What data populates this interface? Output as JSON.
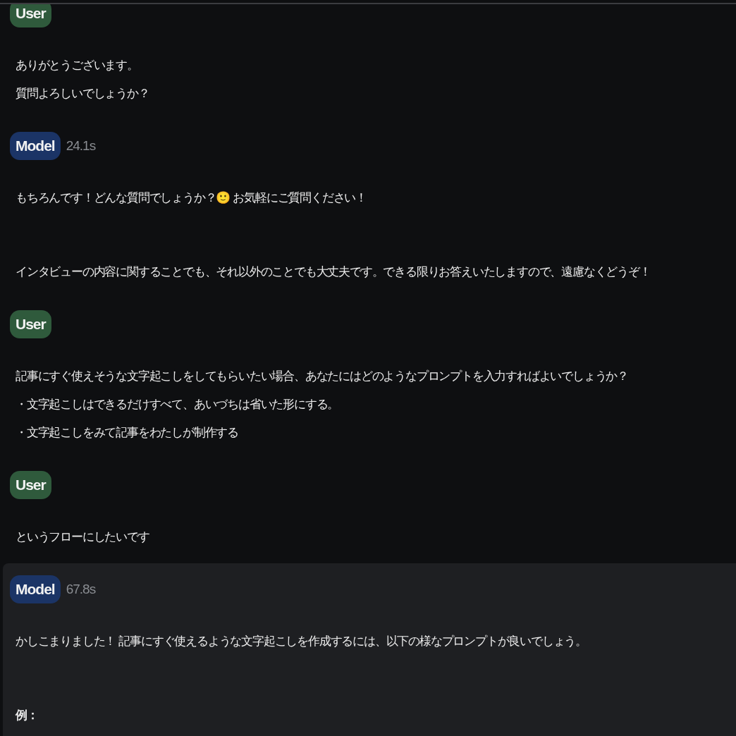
{
  "messages": [
    {
      "kind": "user",
      "role": "User",
      "highlighted": false,
      "paragraphs": [
        {
          "bold": false,
          "lines": [
            "ありがとうございます。",
            "質問よろしいでしょうか？"
          ]
        }
      ]
    },
    {
      "kind": "model",
      "role": "Model",
      "time": "24.1s",
      "highlighted": false,
      "paragraphs": [
        {
          "bold": false,
          "lines": [
            "もちろんです！どんな質問でしょうか？🙂 お気軽にご質問ください！"
          ]
        },
        {
          "bold": false,
          "lines": [
            "インタビューの内容に関することでも、それ以外のことでも大丈夫です。できる限りお答えいたしますので、遠慮なくどうぞ！"
          ]
        }
      ]
    },
    {
      "kind": "user",
      "role": "User",
      "highlighted": false,
      "paragraphs": [
        {
          "bold": false,
          "lines": [
            "記事にすぐ使えそうな文字起こしをしてもらいたい場合、あなたにはどのようなプロンプトを入力すればよいでしょうか？",
            "・文字起こしはできるだけすべて、あいづちは省いた形にする。",
            "・文字起こしをみて記事をわたしが制作する"
          ]
        }
      ]
    },
    {
      "kind": "user",
      "role": "User",
      "highlighted": false,
      "paragraphs": [
        {
          "bold": false,
          "lines": [
            "というフローにしたいです"
          ]
        }
      ]
    },
    {
      "kind": "model",
      "role": "Model",
      "time": "67.8s",
      "highlighted": true,
      "paragraphs": [
        {
          "bold": false,
          "lines": [
            "かしこまりました！ 記事にすぐ使えるような文字起こしを作成するには、以下の様なプロンプトが良いでしょう。"
          ]
        },
        {
          "bold": true,
          "lines": [
            "例："
          ]
        }
      ]
    }
  ]
}
